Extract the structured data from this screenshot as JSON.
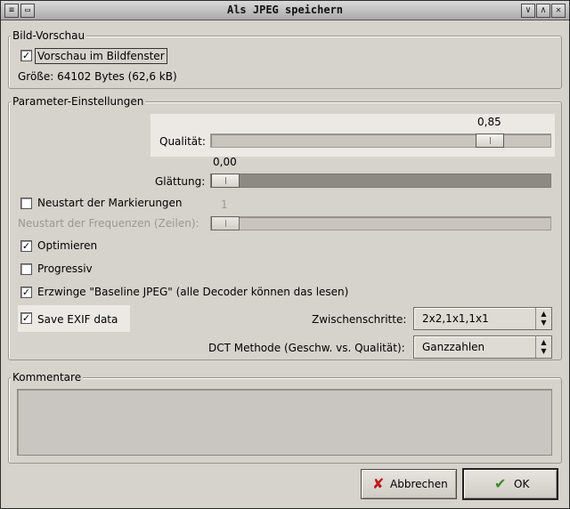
{
  "window": {
    "title": "Als JPEG speichern",
    "left_button_glyph": "≡",
    "right_buttons": [
      "∨",
      "∧",
      "✕"
    ]
  },
  "preview": {
    "group_label": "Bild-Vorschau",
    "checkbox_label": "Vorschau im Bildfenster",
    "checked": true,
    "size_text": "Größe: 64102 Bytes (62,6 kB)"
  },
  "params": {
    "group_label": "Parameter-Einstellungen",
    "quality": {
      "label": "Qualität:",
      "value_text": "0,85",
      "value": 0.85
    },
    "smoothing": {
      "label": "Glättung:",
      "value_text": "0,00",
      "value": 0.0
    },
    "restart_markers": {
      "label": "Neustart der Markierungen",
      "checked": false
    },
    "restart_freq": {
      "label": "Neustart der Frequenzen (Zeilen):",
      "value_text": "1",
      "enabled": false
    },
    "optimize": {
      "label": "Optimieren",
      "checked": true
    },
    "progressive": {
      "label": "Progressiv",
      "checked": false
    },
    "baseline": {
      "label": "Erzwinge \"Baseline JPEG\" (alle Decoder können das lesen)",
      "checked": true
    },
    "save_exif": {
      "label": "Save EXIF data",
      "checked": true
    },
    "subsampling": {
      "label": "Zwischenschritte:",
      "value": "2x2,1x1,1x1"
    },
    "dct": {
      "label": "DCT Methode (Geschw. vs. Qualität):",
      "value": "Ganzzahlen"
    }
  },
  "comments": {
    "group_label": "Kommentare",
    "text": ""
  },
  "buttons": {
    "cancel": {
      "label": "Abbrechen",
      "icon": "cancel-x-icon"
    },
    "ok": {
      "label": "OK",
      "icon": "ok-check-icon"
    }
  },
  "colors": {
    "dialog_bg": "#d6d2cc",
    "highlight_bg": "#ece9e4",
    "cancel_icon": "#c0181b",
    "ok_icon": "#3c8a2a"
  }
}
